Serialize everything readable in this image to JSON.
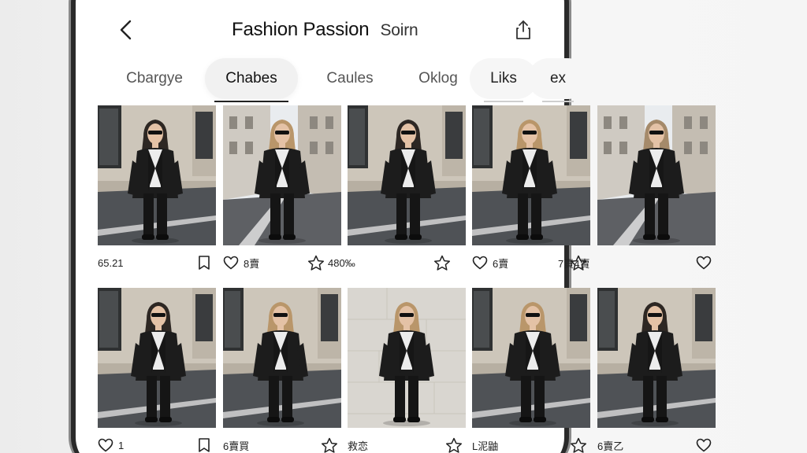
{
  "header": {
    "title": "Fashion Passion",
    "subtitle": "Soirn",
    "back_icon": "chevron-left-icon",
    "share_icon": "share-icon"
  },
  "tabs": [
    {
      "label": "Cbargye",
      "state": "normal"
    },
    {
      "label": "Chabes",
      "state": "active"
    },
    {
      "label": "Caules",
      "state": "normal"
    },
    {
      "label": "Oklog",
      "state": "normal"
    },
    {
      "label": "Liks",
      "state": "soft"
    },
    {
      "label": "ex",
      "state": "soft"
    }
  ],
  "rows": [
    {
      "items": [
        {
          "lead_icon": "",
          "count": "65.21",
          "trail_icon": "bookmark-icon",
          "scene": "building-left",
          "hair": "dark"
        },
        {
          "lead_icon": "heart-icon",
          "count": "8賣",
          "trail_icon": "",
          "scene": "street",
          "hair": "blonde"
        },
        {
          "lead_icon": "",
          "count": "",
          "trail_icon": "",
          "scene": "building",
          "hair": "dark"
        },
        {
          "lead_icon": "heart-icon",
          "count": "6賣",
          "trail_icon": "star-icon",
          "scene": "building",
          "hair": "blonde"
        },
        {
          "lead_icon": "",
          "count": "",
          "trail_icon": "heart-icon",
          "scene": "street",
          "hair": "light"
        }
      ],
      "between_labels": [
        {
          "icon": "star-icon",
          "text": "480‰"
        },
        {
          "icon": "star-icon",
          "text": ""
        },
        {
          "icon": "",
          "text": "7責4賣"
        }
      ]
    },
    {
      "items": [
        {
          "lead_icon": "heart-icon",
          "count": "1",
          "trail_icon": "bookmark-icon",
          "scene": "building-left",
          "hair": "dark"
        },
        {
          "lead_icon": "",
          "count": "6賣買",
          "trail_icon": "star-icon",
          "scene": "building",
          "hair": "blonde"
        },
        {
          "lead_icon": "",
          "count": "救恋",
          "trail_icon": "star-icon",
          "scene": "wall",
          "hair": "blonde"
        },
        {
          "lead_icon": "",
          "count": "L泥鼬",
          "trail_icon": "star-icon",
          "scene": "building",
          "hair": "blonde"
        },
        {
          "lead_icon": "",
          "count": "6賣乙",
          "trail_icon": "heart-icon",
          "scene": "building",
          "hair": "dark"
        }
      ]
    }
  ],
  "colors": {
    "background": "#f3f3f3",
    "card_text": "#222222",
    "outfit": "#1c1c1c",
    "shirt": "#eeeeee"
  }
}
